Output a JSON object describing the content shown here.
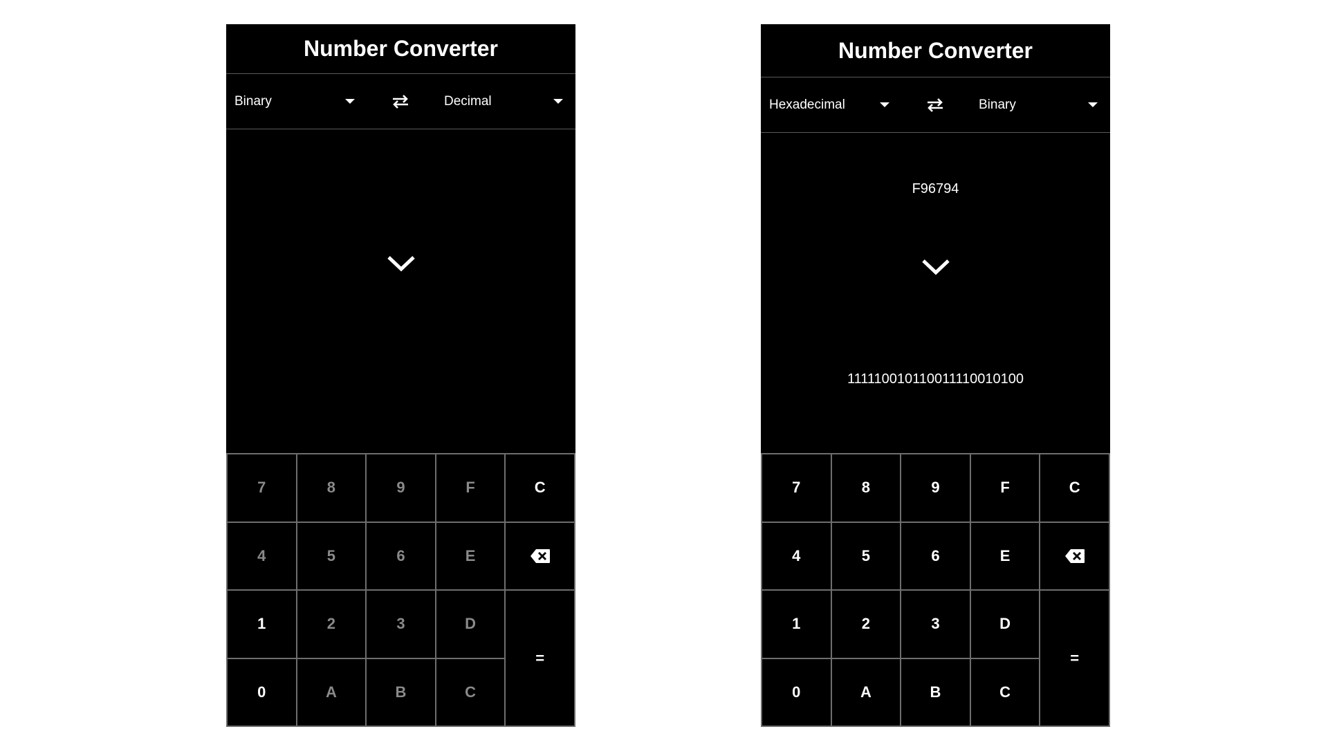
{
  "colors": {
    "background": "#000000",
    "text": "#ffffff",
    "disabled_text": "#8a8a8a",
    "divider": "#6e6e6e",
    "page": "#ffffff"
  },
  "left": {
    "title": "Number Converter",
    "from_base": "Binary",
    "to_base": "Decimal",
    "input_value": "",
    "result_value": "",
    "keys": {
      "k7": "7",
      "k8": "8",
      "k9": "9",
      "kF": "F",
      "kClear": "C",
      "k4": "4",
      "k5": "5",
      "k6": "6",
      "kE": "E",
      "k1": "1",
      "k2": "2",
      "k3": "3",
      "kD": "D",
      "k0": "0",
      "kA": "A",
      "kB": "B",
      "kC": "C",
      "kEquals": "="
    },
    "enabled_keys": [
      "0",
      "1"
    ]
  },
  "right": {
    "title": "Number Converter",
    "from_base": "Hexadecimal",
    "to_base": "Binary",
    "input_value": "F96794",
    "result_value": "111110010110011110010100",
    "keys": {
      "k7": "7",
      "k8": "8",
      "k9": "9",
      "kF": "F",
      "kClear": "C",
      "k4": "4",
      "k5": "5",
      "k6": "6",
      "kE": "E",
      "k1": "1",
      "k2": "2",
      "k3": "3",
      "kD": "D",
      "k0": "0",
      "kA": "A",
      "kB": "B",
      "kC": "C",
      "kEquals": "="
    },
    "enabled_keys": [
      "0",
      "1",
      "2",
      "3",
      "4",
      "5",
      "6",
      "7",
      "8",
      "9",
      "A",
      "B",
      "C",
      "D",
      "E",
      "F"
    ]
  },
  "icons": {
    "dropdown": "caret-down-icon",
    "swap": "swap-arrows-icon",
    "convert": "chevron-down-icon",
    "backspace": "backspace-icon"
  }
}
